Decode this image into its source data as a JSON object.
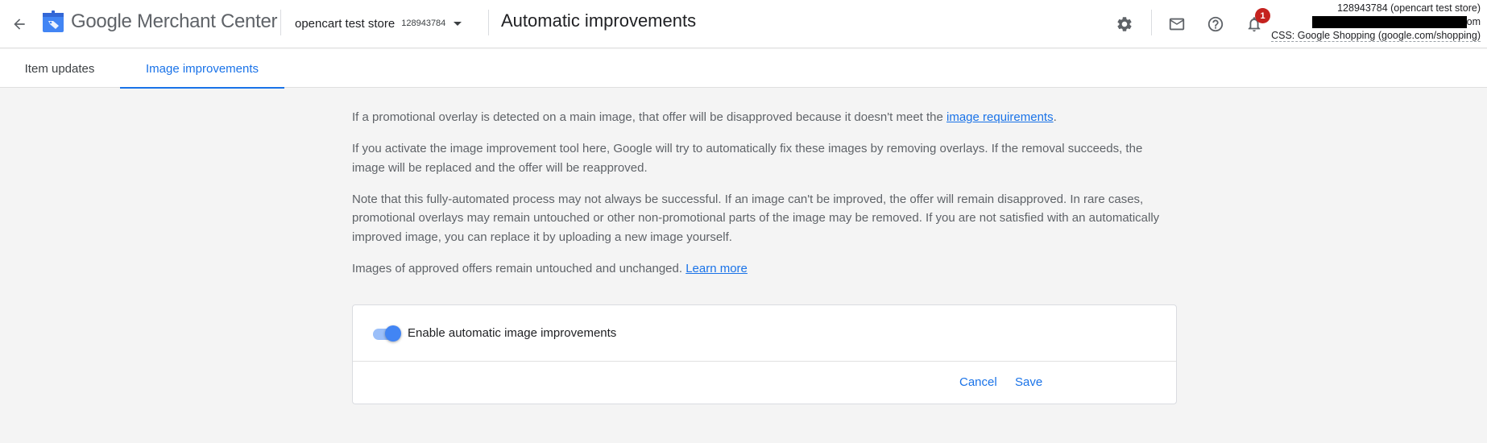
{
  "header": {
    "back_icon": "arrow-back-icon",
    "logo_icon": "merchant-center-tag-icon",
    "product_name": "Google Merchant Center",
    "account": {
      "name": "opencart test store",
      "id": "128943784",
      "dropdown_icon": "caret-down-icon"
    },
    "page_title": "Automatic improvements",
    "icons": {
      "settings": "gear-icon",
      "mail": "mail-icon",
      "help": "help-icon",
      "notifications": "bell-icon"
    },
    "notification_count": "1",
    "account_info": {
      "line1": "128943784 (opencart test store)",
      "line2_suffix": "om",
      "line3": "CSS: Google Shopping (google.com/shopping)"
    }
  },
  "tabs": [
    {
      "label": "Item updates",
      "active": false
    },
    {
      "label": "Image improvements",
      "active": true
    }
  ],
  "content": {
    "p1_text": "If a promotional overlay is detected on a main image, that offer will be disapproved because it doesn't meet the ",
    "p1_link": "image requirements",
    "p1_end": ".",
    "p2": "If you activate the image improvement tool here, Google will try to automatically fix these images by removing overlays. If the removal succeeds, the image will be replaced and the offer will be reapproved.",
    "p3": "Note that this fully-automated process may not always be successful. If an image can't be improved, the offer will remain disapproved. In rare cases, promotional overlays may remain untouched or other non-promotional parts of the image may be removed. If you are not satisfied with an automatically improved image, you can replace it by uploading a new image yourself.",
    "p4_text": "Images of approved offers remain untouched and unchanged. ",
    "p4_link": "Learn more"
  },
  "card": {
    "toggle_label": "Enable automatic image improvements",
    "toggle_on": true,
    "cancel_label": "Cancel",
    "save_label": "Save"
  },
  "colors": {
    "accent": "#1a73e8",
    "badge": "#c5221f",
    "toggle_knob": "#4285f4",
    "toggle_track": "#8ab4f8"
  }
}
